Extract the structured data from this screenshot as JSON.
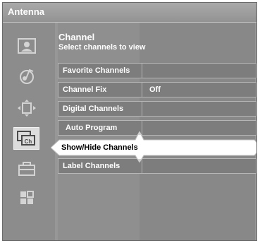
{
  "window": {
    "title": "Antenna"
  },
  "sidebar": {
    "icons": [
      "picture-icon",
      "sound-icon",
      "screen-icon",
      "channel-icon",
      "setup-icon",
      "features-icon"
    ],
    "selected": "channel-icon",
    "selected_icon_text": "Ch"
  },
  "menu": {
    "title": "Channel",
    "subtitle": "Select channels to view",
    "items": [
      {
        "label": "Favorite Channels",
        "value": ""
      },
      {
        "label": "Channel Fix",
        "value": "Off"
      },
      {
        "label": "Digital Channels",
        "value": ""
      },
      {
        "label": "Auto Program",
        "value": ""
      },
      {
        "label": "Show/Hide Channels",
        "value": "",
        "selected": true
      },
      {
        "label": "Label Channels",
        "value": ""
      }
    ]
  },
  "colors": {
    "background": "#8e8e8e",
    "selection": "#ffffff",
    "text": "#ffffff"
  }
}
